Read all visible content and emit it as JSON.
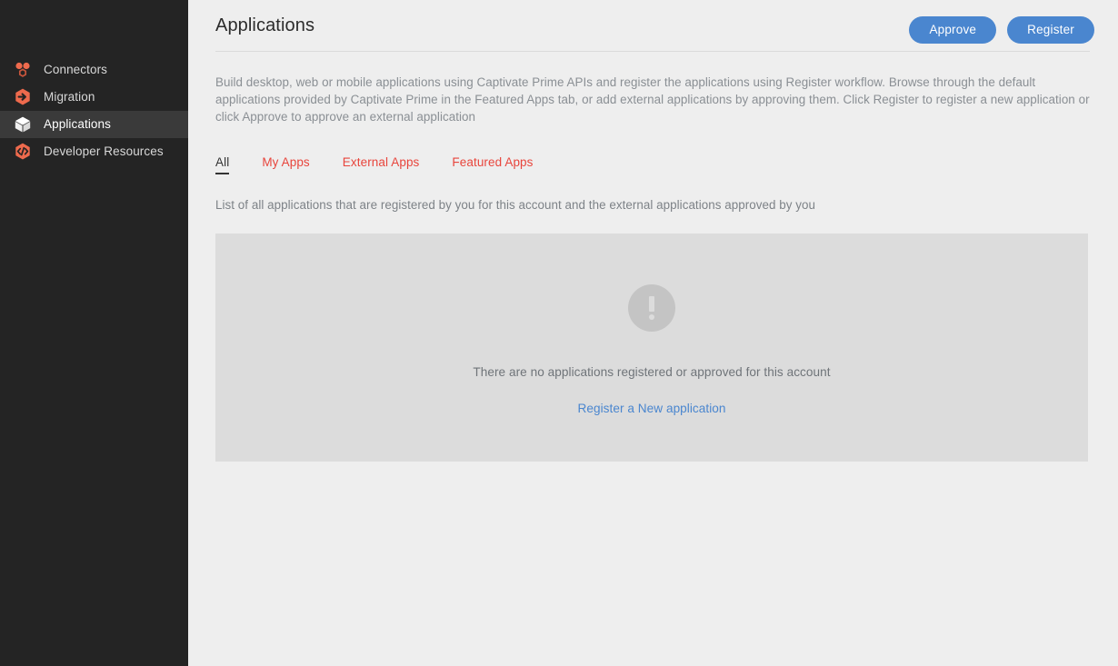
{
  "sidebar": {
    "items": [
      {
        "label": "Connectors",
        "icon": "connectors-icon",
        "active": false
      },
      {
        "label": "Migration",
        "icon": "migration-icon",
        "active": false
      },
      {
        "label": "Applications",
        "icon": "applications-cube-icon",
        "active": true
      },
      {
        "label": "Developer Resources",
        "icon": "code-brackets-icon",
        "active": false
      }
    ]
  },
  "header": {
    "title": "Applications",
    "approve_label": "Approve",
    "register_label": "Register"
  },
  "intro": {
    "text": "Build desktop, web or mobile applications using Captivate Prime APIs and register the applications using Register workflow. Browse through the default applications provided by Captivate Prime in the Featured Apps tab, or add external applications by approving them. Click Register to register a new application or click Approve to approve an external application"
  },
  "tabs": [
    {
      "label": "All",
      "active": true
    },
    {
      "label": "My Apps",
      "active": false
    },
    {
      "label": "External Apps",
      "active": false
    },
    {
      "label": "Featured Apps",
      "active": false
    }
  ],
  "tab_description": "List of all applications that are registered by you for this account and the external applications approved by you",
  "empty_state": {
    "icon": "exclamation-circle-icon",
    "message": "There are no applications registered or approved for this account",
    "link_label": "Register a New application"
  },
  "colors": {
    "accent_orange": "#ee6a4d",
    "tab_red": "#e8453c",
    "button_blue": "#4a86cf",
    "link_blue": "#4a86cf",
    "sidebar_bg": "#242424",
    "sidebar_active_bg": "#3a3a3a",
    "page_bg": "#eeeeee",
    "panel_bg": "#dcdcdc"
  }
}
